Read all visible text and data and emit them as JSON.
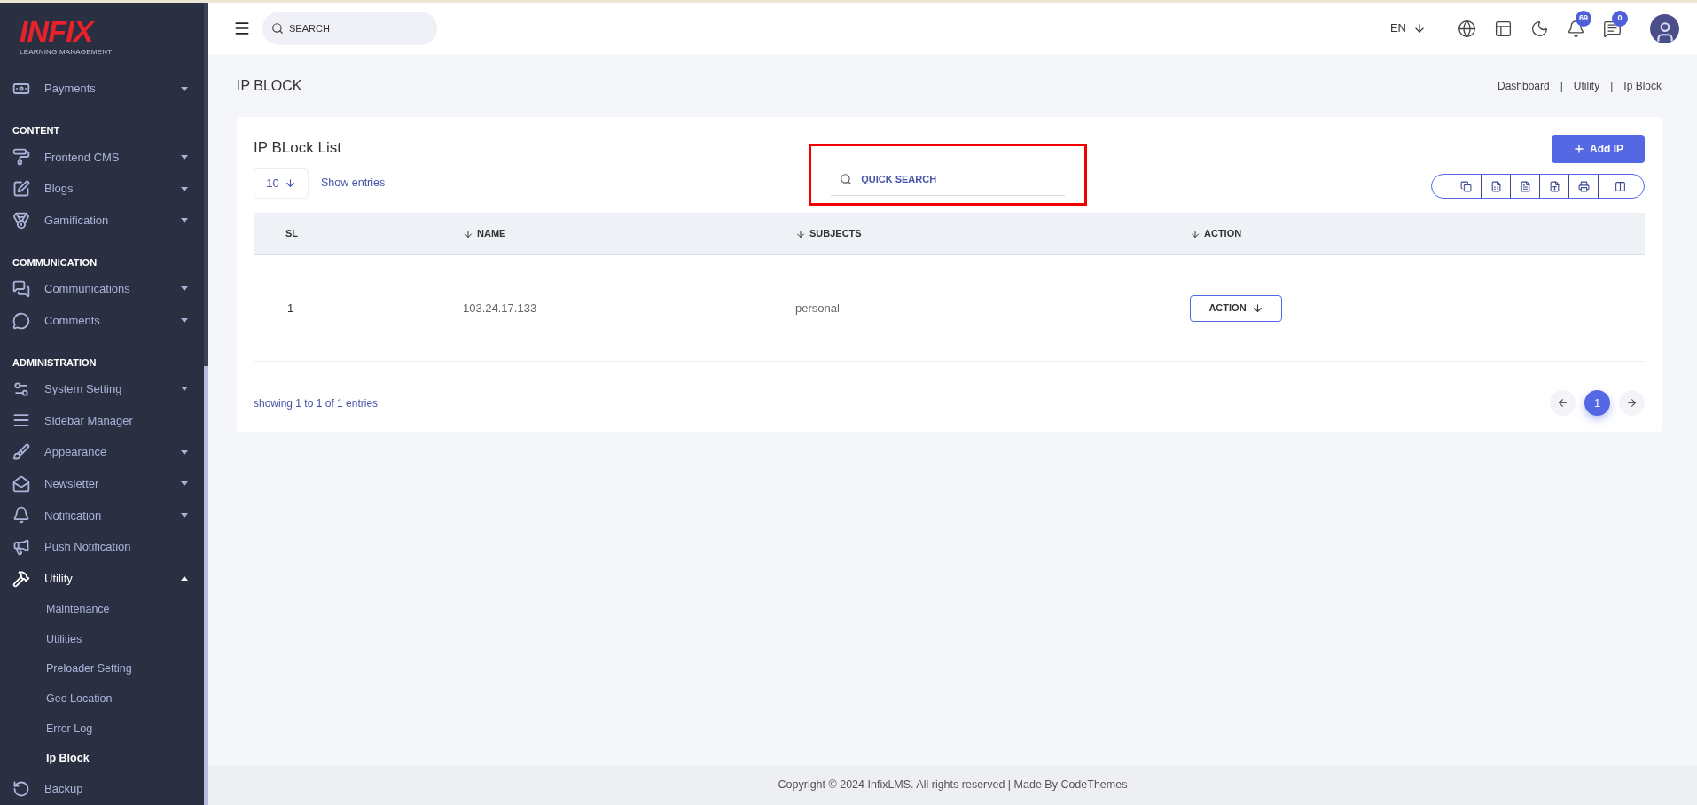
{
  "sidebar": {
    "logo": {
      "word": "INFIX",
      "tagline": "LEARNING MANAGEMENT"
    },
    "items": [
      {
        "kind": "item",
        "label": "Payments",
        "expandable": true,
        "expanded": false
      },
      {
        "kind": "section",
        "label": "CONTENT"
      },
      {
        "kind": "item",
        "label": "Frontend CMS",
        "expandable": true,
        "expanded": false
      },
      {
        "kind": "item",
        "label": "Blogs",
        "expandable": true,
        "expanded": false
      },
      {
        "kind": "item",
        "label": "Gamification",
        "expandable": true,
        "expanded": false
      },
      {
        "kind": "section",
        "label": "COMMUNICATION"
      },
      {
        "kind": "item",
        "label": "Communications",
        "expandable": true,
        "expanded": false
      },
      {
        "kind": "item",
        "label": "Comments",
        "expandable": true,
        "expanded": false
      },
      {
        "kind": "section",
        "label": "ADMINISTRATION"
      },
      {
        "kind": "item",
        "label": "System Setting",
        "expandable": true,
        "expanded": false
      },
      {
        "kind": "item",
        "label": "Sidebar Manager",
        "expandable": false,
        "expanded": false
      },
      {
        "kind": "item",
        "label": "Appearance",
        "expandable": true,
        "expanded": false
      },
      {
        "kind": "item",
        "label": "Newsletter",
        "expandable": true,
        "expanded": false
      },
      {
        "kind": "item",
        "label": "Notification",
        "expandable": true,
        "expanded": false
      },
      {
        "kind": "item",
        "label": "Push Notification",
        "expandable": false,
        "expanded": false
      },
      {
        "kind": "item",
        "label": "Utility",
        "expandable": true,
        "expanded": true,
        "children": [
          {
            "label": "Maintenance",
            "selected": false
          },
          {
            "label": "Utilities",
            "selected": false
          },
          {
            "label": "Preloader Setting",
            "selected": false
          },
          {
            "label": "Geo Location",
            "selected": false
          },
          {
            "label": "Error Log",
            "selected": false
          },
          {
            "label": "Ip Block",
            "selected": true
          }
        ]
      },
      {
        "kind": "item",
        "label": "Backup",
        "expandable": false,
        "expanded": false
      }
    ]
  },
  "header": {
    "search": {
      "placeholder": "SEARCH"
    },
    "language": "EN",
    "notifications_badge": "69",
    "messages_badge": "0"
  },
  "page": {
    "title": "IP BLOCK",
    "breadcrumb": [
      "Dashboard",
      "Utility",
      "Ip Block"
    ],
    "breadcrumb_separator": "|"
  },
  "card": {
    "title": "IP BLock List",
    "add_button": "Add IP",
    "page_size": "10",
    "show_entries": "Show entries",
    "quick_search": {
      "placeholder": "QUICK SEARCH",
      "highlighted": true
    },
    "table": {
      "columns": [
        {
          "label": "SL",
          "sortable": false
        },
        {
          "label": "NAME",
          "sortable": true
        },
        {
          "label": "SUBJECTS",
          "sortable": true
        },
        {
          "label": "ACTION",
          "sortable": true
        }
      ],
      "rows": [
        {
          "sl": "1",
          "name": "103.24.17.133",
          "subject": "personal",
          "action": "ACTION"
        }
      ]
    },
    "summary": "showing 1 to 1 of 1 entries",
    "pages": [
      {
        "label": "1",
        "selected": true
      }
    ]
  },
  "footer": "Copyright © 2024 InfixLMS. All rights reserved | Made By CodeThemes"
}
